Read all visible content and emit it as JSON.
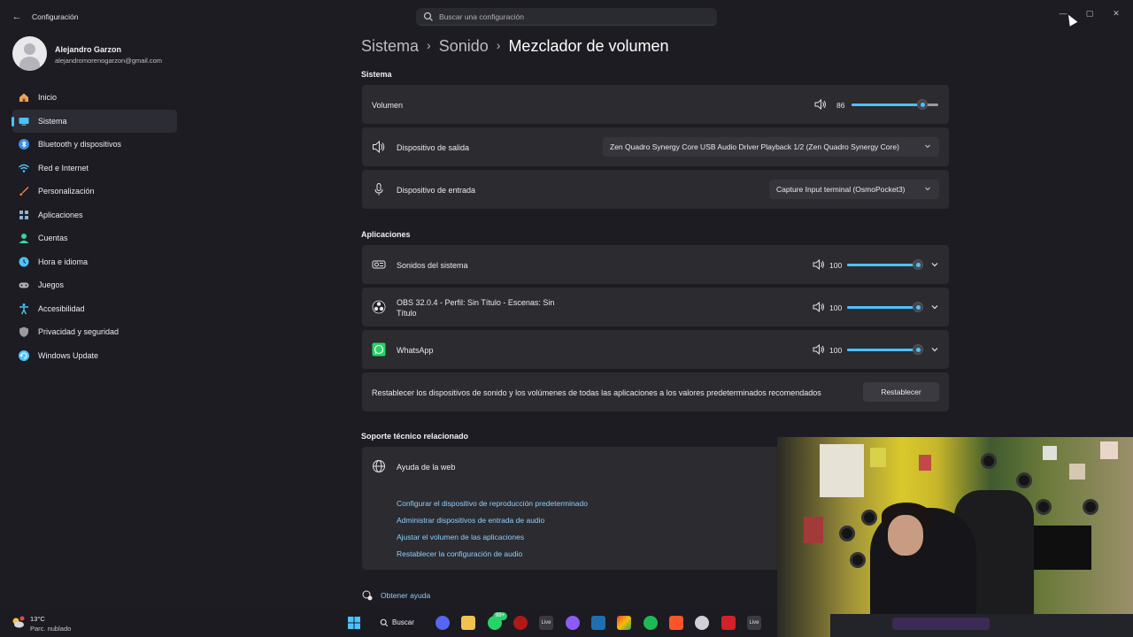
{
  "window": {
    "title": "Configuración",
    "back_glyph": "←",
    "search_placeholder": "Buscar una configuración",
    "minimize_glyph": "—",
    "maximize_glyph": "▢",
    "close_glyph": "✕"
  },
  "profile": {
    "name": "Alejandro Garzon",
    "email": "alejandromorenogarzon@gmail.com"
  },
  "sidebar": {
    "items": [
      {
        "label": "Inicio",
        "icon": "home-icon",
        "color": "#f0a35a"
      },
      {
        "label": "Sistema",
        "icon": "system-icon",
        "color": "#4cc2ff",
        "active": true
      },
      {
        "label": "Bluetooth y dispositivos",
        "icon": "bluetooth-icon",
        "color": "#3a8ee6"
      },
      {
        "label": "Red e Internet",
        "icon": "wifi-icon",
        "color": "#4cc2ff"
      },
      {
        "label": "Personalización",
        "icon": "brush-icon",
        "color": "#e8864a"
      },
      {
        "label": "Aplicaciones",
        "icon": "apps-icon",
        "color": "#8ab4d8"
      },
      {
        "label": "Cuentas",
        "icon": "account-icon",
        "color": "#3ecf9e"
      },
      {
        "label": "Hora e idioma",
        "icon": "globe-clock-icon",
        "color": "#4cc2ff"
      },
      {
        "label": "Juegos",
        "icon": "gamepad-icon",
        "color": "#b0b0b8"
      },
      {
        "label": "Accesibilidad",
        "icon": "accessibility-icon",
        "color": "#4cc2ff"
      },
      {
        "label": "Privacidad y seguridad",
        "icon": "shield-icon",
        "color": "#9a9aa2"
      },
      {
        "label": "Windows Update",
        "icon": "update-icon",
        "color": "#4cc2ff"
      }
    ]
  },
  "breadcrumb": {
    "part1": "Sistema",
    "part2": "Sonido",
    "current": "Mezclador de volumen",
    "separator": "›"
  },
  "system_section": {
    "title": "Sistema",
    "volume": {
      "label": "Volumen",
      "value": "86",
      "level": 0.86
    },
    "output": {
      "label": "Dispositivo de salida",
      "selected": "Zen Quadro Synergy Core USB Audio Driver Playback 1/2 (Zen Quadro Synergy Core)"
    },
    "input": {
      "label": "Dispositivo de entrada",
      "selected": "Capture Input terminal (OsmoPocket3)"
    }
  },
  "apps_section": {
    "title": "Aplicaciones",
    "apps": [
      {
        "name": "Sonidos del sistema",
        "value": "100",
        "level": 1.0,
        "icon": "system-sounds-icon"
      },
      {
        "name_line1": "OBS 32.0.4 - Perfil: Sin Título - Escenas: Sin",
        "name_line2": "Título",
        "value": "100",
        "level": 1.0,
        "icon": "obs-icon"
      },
      {
        "name": "WhatsApp",
        "value": "100",
        "level": 1.0,
        "icon": "whatsapp-icon"
      }
    ],
    "reset_text": "Restablecer los dispositivos de sonido y los volúmenes de todas las aplicaciones a los valores predeterminados recomendados",
    "reset_button": "Restablecer"
  },
  "support": {
    "title": "Soporte técnico relacionado",
    "web_help": "Ayuda de la web",
    "links": [
      "Configurar el dispositivo de reproducción predeterminado",
      "Administrar dispositivos de entrada de audio",
      "Ajustar el volumen de las aplicaciones",
      "Restablecer la configuración de audio"
    ],
    "get_help": "Obtener ayuda"
  },
  "taskbar": {
    "temperature": "13°C",
    "weather": "Parc. nublado",
    "search_label": "Buscar",
    "whatsapp_badge": "99+",
    "live_label": "Live"
  },
  "colors": {
    "accent": "#4cc2ff",
    "background": "#1c1c22",
    "card": "#2b2b30"
  }
}
